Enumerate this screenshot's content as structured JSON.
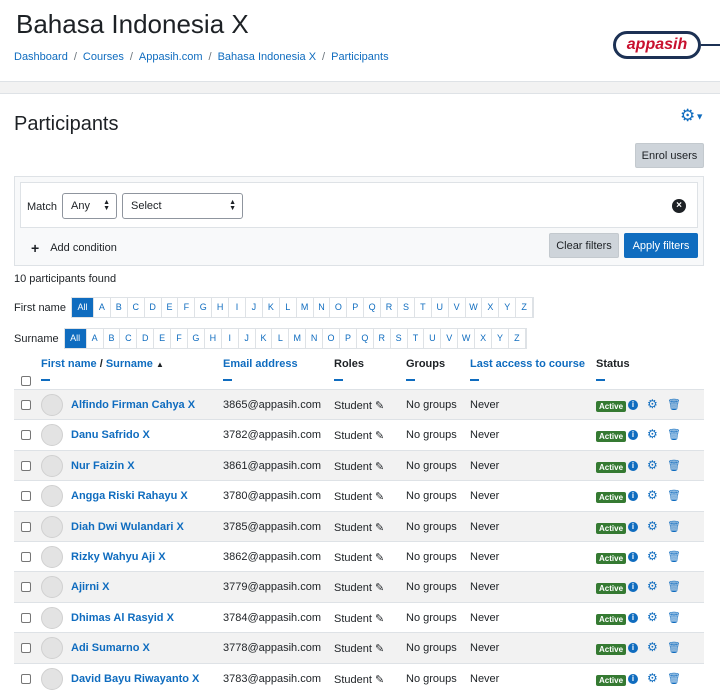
{
  "course": {
    "title": "Bahasa Indonesia X",
    "breadcrumb": [
      "Dashboard",
      "Courses",
      "Appasih.com",
      "Bahasa Indonesia X",
      "Participants"
    ]
  },
  "logo": {
    "text": "appasih"
  },
  "page": {
    "heading": "Participants",
    "enrol_label": "Enrol users"
  },
  "filters": {
    "match_label": "Match",
    "match_value": "Any",
    "select_value": "Select",
    "add_condition": "Add condition",
    "clear_label": "Clear filters",
    "apply_label": "Apply filters"
  },
  "found_text": "10 participants found",
  "initials": {
    "first_label": "First name",
    "surname_label": "Surname",
    "all_label": "All",
    "letters": [
      "A",
      "B",
      "C",
      "D",
      "E",
      "F",
      "G",
      "H",
      "I",
      "J",
      "K",
      "L",
      "M",
      "N",
      "O",
      "P",
      "Q",
      "R",
      "S",
      "T",
      "U",
      "V",
      "W",
      "X",
      "Y",
      "Z"
    ]
  },
  "table": {
    "headers": {
      "first_name": "First name",
      "slash": " / ",
      "surname": "Surname",
      "email": "Email address",
      "roles": "Roles",
      "groups": "Groups",
      "last_access": "Last access to course",
      "status": "Status"
    },
    "rows": [
      {
        "name": "Alfindo Firman Cahya X",
        "email": "3865@appasih.com",
        "role": "Student",
        "group": "No groups",
        "access": "Never",
        "status": "Active"
      },
      {
        "name": "Danu Safrido X",
        "email": "3782@appasih.com",
        "role": "Student",
        "group": "No groups",
        "access": "Never",
        "status": "Active"
      },
      {
        "name": "Nur Faizin X",
        "email": "3861@appasih.com",
        "role": "Student",
        "group": "No groups",
        "access": "Never",
        "status": "Active"
      },
      {
        "name": "Angga Riski Rahayu X",
        "email": "3780@appasih.com",
        "role": "Student",
        "group": "No groups",
        "access": "Never",
        "status": "Active"
      },
      {
        "name": "Diah Dwi Wulandari X",
        "email": "3785@appasih.com",
        "role": "Student",
        "group": "No groups",
        "access": "Never",
        "status": "Active"
      },
      {
        "name": "Rizky Wahyu Aji X",
        "email": "3862@appasih.com",
        "role": "Student",
        "group": "No groups",
        "access": "Never",
        "status": "Active"
      },
      {
        "name": "Ajirni X",
        "email": "3779@appasih.com",
        "role": "Student",
        "group": "No groups",
        "access": "Never",
        "status": "Active"
      },
      {
        "name": "Dhimas Al Rasyid X",
        "email": "3784@appasih.com",
        "role": "Student",
        "group": "No groups",
        "access": "Never",
        "status": "Active"
      },
      {
        "name": "Adi Sumarno X",
        "email": "3778@appasih.com",
        "role": "Student",
        "group": "No groups",
        "access": "Never",
        "status": "Active"
      },
      {
        "name": "David Bayu Riwayanto X",
        "email": "3783@appasih.com",
        "role": "Student",
        "group": "No groups",
        "access": "Never",
        "status": "Active"
      }
    ]
  },
  "icons": {
    "gear": "gear-icon",
    "caret": "caret-down-icon",
    "plus": "plus-icon",
    "remove": "remove-condition-icon",
    "sort": "sort-ascending-icon",
    "pencil": "pencil-icon",
    "info": "info-icon",
    "cog": "cog-icon",
    "trash": "trash-icon"
  },
  "colors": {
    "primary": "#0f6cbf",
    "active_badge": "#357a32",
    "logo_red": "#c8102e",
    "logo_navy": "#1c3154"
  }
}
